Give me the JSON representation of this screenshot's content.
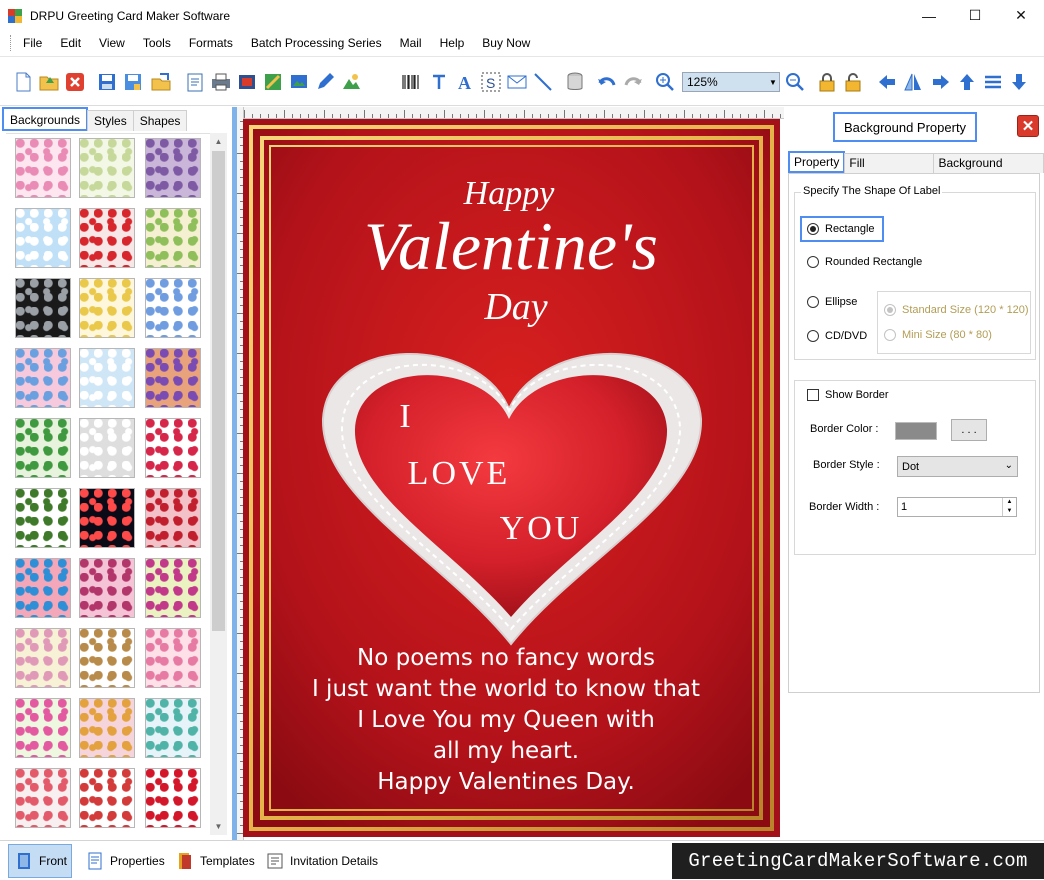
{
  "window": {
    "title": "DRPU Greeting Card Maker Software",
    "minimize_glyph": "—",
    "maximize_glyph": "☐",
    "close_glyph": "✕"
  },
  "menu": [
    "File",
    "Edit",
    "View",
    "Tools",
    "Formats",
    "Batch Processing Series",
    "Mail",
    "Help",
    "Buy Now"
  ],
  "toolbar": {
    "zoom_value": "125%",
    "icons": [
      "new-icon",
      "open-icon",
      "close-file-icon",
      "save-icon",
      "save-as-icon",
      "export-icon",
      "properties-icon",
      "print-icon",
      "print-preview-icon",
      "image-export-icon",
      "insert-image-icon",
      "pencil-icon",
      "shape-icon",
      "barcode-icon",
      "text-icon",
      "word-art-icon",
      "signature-icon",
      "mail-icon",
      "line-icon",
      "database-icon",
      "undo-icon",
      "redo-icon",
      "zoom-in-icon",
      "zoom-out-icon",
      "lock-icon",
      "unlock-icon",
      "flip-left-icon",
      "mirror-icon",
      "arrow-right-icon",
      "arrow-up-icon",
      "align-icon",
      "arrow-down-icon"
    ]
  },
  "left_panel": {
    "tabs": [
      "Backgrounds",
      "Styles",
      "Shapes"
    ],
    "active_tab": "Backgrounds",
    "thumbnail_count": 30
  },
  "card": {
    "heading_small_top": "Happy",
    "heading_large": "Valentine's",
    "heading_small_bottom": "Day",
    "heart_line1": "I",
    "heart_line2": "LOVE",
    "heart_line3": "YOU",
    "poem": [
      "No poems no fancy words",
      "I just want the world to know that",
      "I Love You my Queen with",
      "all my heart.",
      "Happy Valentines Day."
    ],
    "colors": {
      "background": "#b3121a",
      "gold": "#e5b34a",
      "heart": "#d4202a"
    }
  },
  "right_panel": {
    "title": "Background Property",
    "tabs": [
      "Property",
      "Fill Background",
      "Background Effects"
    ],
    "active_tab": "Property",
    "shape_group_label": "Specify The Shape Of Label",
    "shape_options": [
      "Rectangle",
      "Rounded Rectangle",
      "Ellipse",
      "CD/DVD"
    ],
    "selected_shape": "Rectangle",
    "size_options": [
      "Standard Size (120 * 120)",
      "Mini Size (80 * 80)"
    ],
    "show_border_label": "Show Border",
    "border_color_label": "Border Color :",
    "border_color_button": ". . .",
    "border_style_label": "Border Style :",
    "border_style_value": "Dot",
    "border_width_label": "Border Width :",
    "border_width_value": "1"
  },
  "bottom_bar": {
    "tabs": [
      "Front",
      "Properties",
      "Templates",
      "Invitation Details"
    ],
    "brand": "GreetingCardMakerSoftware.com"
  }
}
